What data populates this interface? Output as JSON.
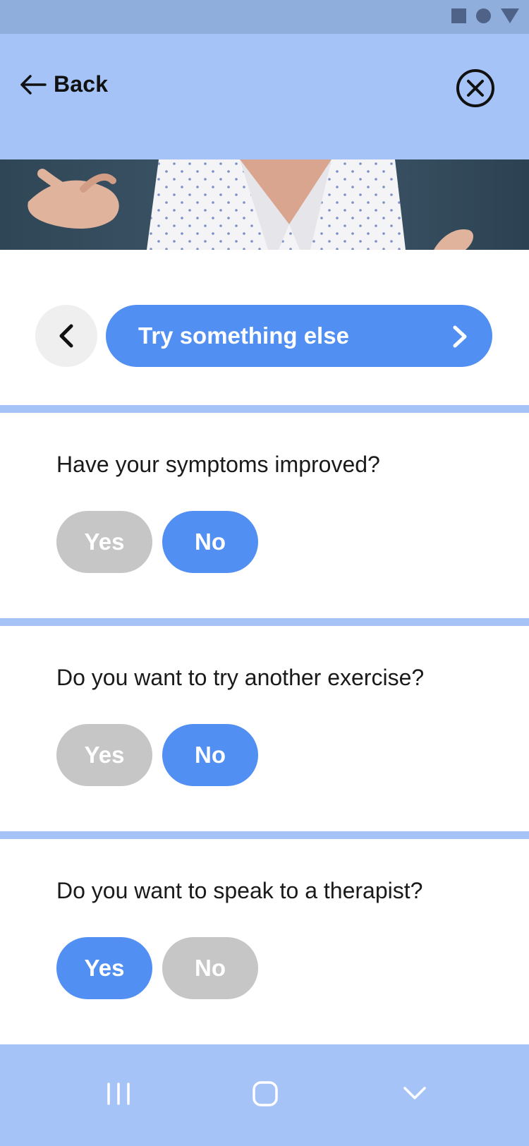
{
  "status_bar": {
    "icons": [
      "square-icon",
      "circle-icon",
      "triangle-icon"
    ]
  },
  "header": {
    "back_label": "Back",
    "back_icon": "arrow-left-icon",
    "close_icon": "close-circle-icon"
  },
  "hero": {
    "image": "video-thumbnail-person-gesturing"
  },
  "navigation": {
    "prev_icon": "chevron-left-icon",
    "next_label": "Try something else",
    "next_icon": "chevron-right-icon"
  },
  "questions": [
    {
      "text": "Have your symptoms improved?",
      "yes_label": "Yes",
      "no_label": "No",
      "selected": "No"
    },
    {
      "text": "Do you want to try another exercise?",
      "yes_label": "Yes",
      "no_label": "No",
      "selected": "No"
    },
    {
      "text": "Do you want to speak to a therapist?",
      "yes_label": "Yes",
      "no_label": "No",
      "selected": "Yes"
    }
  ],
  "system_nav": {
    "icons": [
      "recent-apps-icon",
      "home-icon",
      "back-chevron-icon"
    ]
  },
  "colors": {
    "accent": "#528ff2",
    "header_bg": "#a5c3f7",
    "status_bg": "#8faedb",
    "inactive": "#c6c6c6"
  }
}
